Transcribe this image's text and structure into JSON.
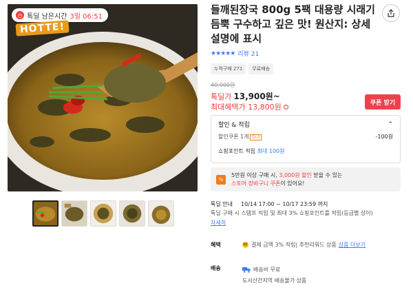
{
  "timer": {
    "label": "톡딜 남은시간",
    "value": "3일 06:51"
  },
  "brand_logo_text": "HOTTE!",
  "product": {
    "title": "들깨된장국 800g 5팩 대용량 시래기듬뿍 구수하고 깊은 맛! 원산지: 상세설명에 표시"
  },
  "rating": {
    "stars": 5,
    "review_label": "리뷰 21"
  },
  "chips": [
    "누적구매 271",
    "무료배송"
  ],
  "price": {
    "original": "40,000원",
    "deal_label": "톡딜가",
    "deal_value": "13,900원~",
    "max_label": "최대혜택가 13,800원",
    "coupon_button": "쿠폰 받기"
  },
  "discount": {
    "header": "할인 & 적립",
    "coupon_label": "할인쿠폰 1개",
    "coupon_tag": "D-3",
    "coupon_value": "-100원",
    "point_label": "쇼핑포인트 적립",
    "point_value": "최대 100원"
  },
  "promo": {
    "line1_a": "5만원 이상 구매 시,",
    "line1_b": "3,000원 할인",
    "line1_c": "받을 수 있는",
    "line2_a": "스토어 장바구니 쿠폰",
    "line2_b": "이 있어요!"
  },
  "sale_info": {
    "label": "톡딜 안내",
    "period": "10/14 17:00 ~ 10/17 23:59 까지",
    "desc": "톡딜 구매 시 스탬프 적립 및 최대 3% 쇼핑포인트를 적립(등급별 상이)",
    "detail_link": "자세히"
  },
  "benefit": {
    "label": "혜택",
    "text": "결제 금액 3% 적립| 추천리워드 상품",
    "link": "상품 더보기"
  },
  "shipping": {
    "label": "배송",
    "line1": "배송비 무료",
    "line2": "도서산간지역 배송불가 상품"
  },
  "icons": {
    "share": "share-icon",
    "coin": "kakao-coin-icon",
    "truck": "truck-icon"
  },
  "colors": {
    "accent_red": "#f03c3c",
    "accent_blue": "#3d7bf0",
    "coupon_button": "#f23f4c",
    "orange": "#f07c1c"
  }
}
